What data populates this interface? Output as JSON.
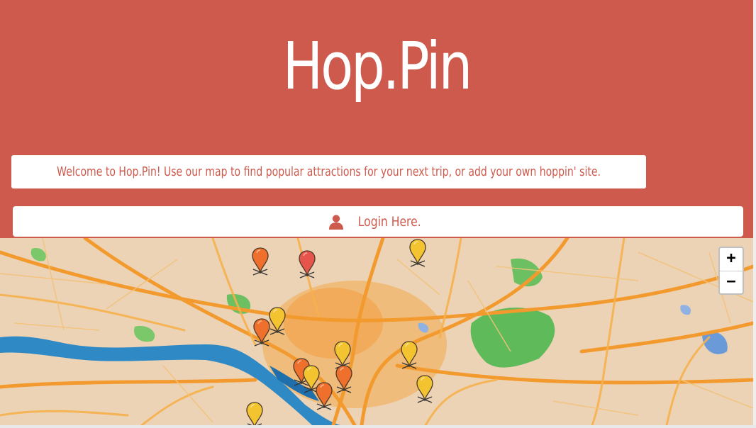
{
  "header": {
    "title": "Hop.Pin",
    "welcome": "Welcome to Hop.Pin! Use our map to find popular attractions for your next trip, or add your own hoppin' site.",
    "login_label": "Login Here.",
    "login_icon": "user-icon"
  },
  "map": {
    "zoom_in": "+",
    "zoom_out": "−",
    "markers": [
      {
        "color": "#ef6f2c"
      },
      {
        "color": "#e6554c"
      },
      {
        "color": "#f4c430"
      },
      {
        "color": "#f4c430"
      },
      {
        "color": "#ef6f2c"
      },
      {
        "color": "#f4c430"
      },
      {
        "color": "#f4c430"
      },
      {
        "color": "#ef6f2c"
      },
      {
        "color": "#f4c430"
      },
      {
        "color": "#ef6f2c"
      },
      {
        "color": "#ef6f2c"
      },
      {
        "color": "#f4c430"
      },
      {
        "color": "#f4c430"
      }
    ]
  },
  "colors": {
    "brand": "#cd5a4d",
    "water": "#2e89c4",
    "park": "#5cb85c",
    "road": "#f0a33a"
  }
}
